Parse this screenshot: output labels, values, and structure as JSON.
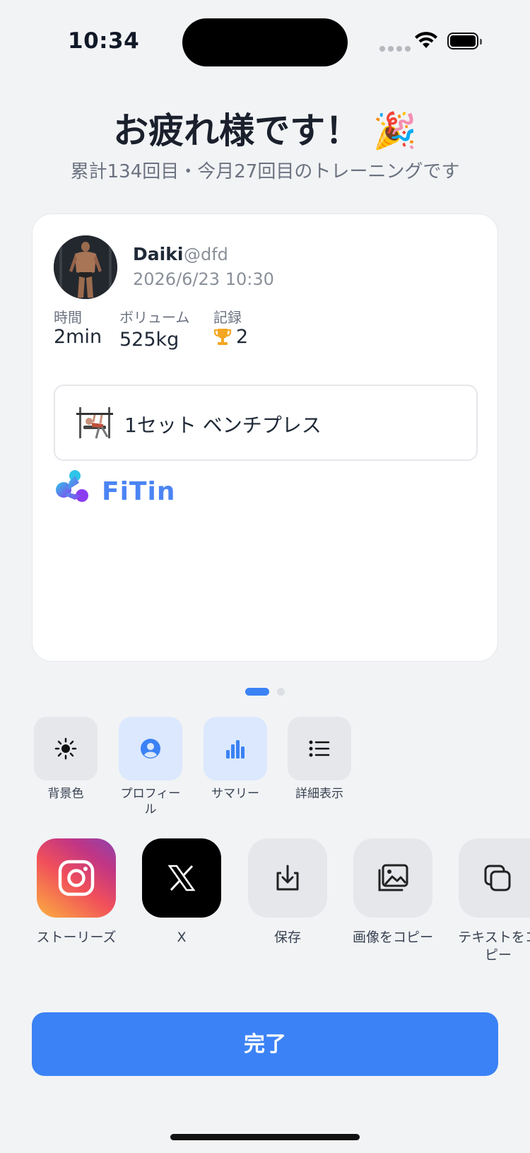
{
  "status_bar": {
    "time": "10:34"
  },
  "header": {
    "title": "お疲れ様です！",
    "emoji": "🎉",
    "subtitle": "累計134回目・今月27回目のトレーニングです"
  },
  "card": {
    "user": {
      "name": "Daiki",
      "handle": "@dfd",
      "datetime": "2026/6/23 10:30"
    },
    "stats": [
      {
        "label": "時間",
        "value": "2min"
      },
      {
        "label": "ボリューム",
        "value": "525kg"
      },
      {
        "label": "記録",
        "value": "2",
        "icon": "trophy-icon"
      }
    ],
    "exercise": {
      "label": "1セット ベンチプレス",
      "icon": "bench-press-thumbnail"
    },
    "brand": "FiTin"
  },
  "pager": {
    "pages": 2,
    "active": 1
  },
  "options": [
    {
      "label": "背景色",
      "icon": "sun-icon",
      "active": false
    },
    {
      "label": "プロフィール",
      "icon": "person-circle-icon",
      "active": true
    },
    {
      "label": "サマリー",
      "icon": "bar-chart-icon",
      "active": true
    },
    {
      "label": "詳細表示",
      "icon": "list-icon",
      "active": false
    }
  ],
  "share": [
    {
      "label": "ストーリーズ",
      "icon": "instagram-icon"
    },
    {
      "label": "X",
      "icon": "x-logo-icon"
    },
    {
      "label": "保存",
      "icon": "download-icon"
    },
    {
      "label": "画像をコピー",
      "icon": "image-icon"
    },
    {
      "label": "テキストをコピー",
      "icon": "copy-icon"
    }
  ],
  "colors": {
    "accent": "#3b82f6",
    "accent_light": "#dbe8fd",
    "neutral_tile": "#e5e7eb",
    "trophy": "#f5a623"
  },
  "footer": {
    "done_label": "完了"
  }
}
